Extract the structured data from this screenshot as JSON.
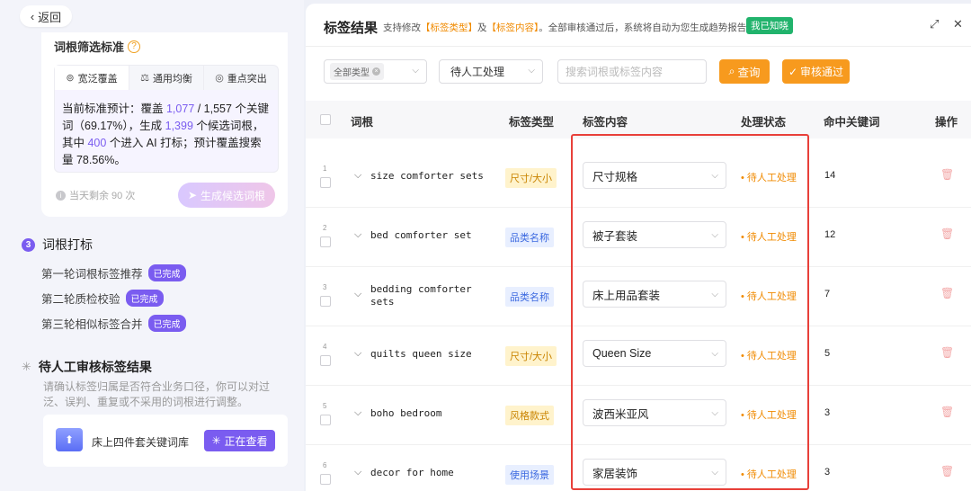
{
  "left": {
    "back_label": "返回",
    "card_title": "词根筛选标准",
    "help_symbol": "?",
    "tabs": [
      {
        "label": "宽泛覆盖",
        "icon": "broadcast-icon"
      },
      {
        "label": "通用均衡",
        "icon": "balance-icon"
      },
      {
        "label": "重点突出",
        "icon": "target-icon"
      }
    ],
    "estimate": {
      "t1": "当前标准预计：覆盖 ",
      "covered": "1,077",
      "t2": " / 1,557 个关键词（69.17%），生成 ",
      "generated": "1,399",
      "t3": " 个候选词根，其中 ",
      "ai_count": "400",
      "t4": " 个进入 AI 打标；预计覆盖搜索量 78.56%。"
    },
    "remain_text": "当天剩余 90 次",
    "generate_label": "生成候选词根",
    "step3": {
      "num": "3",
      "title": "词根打标"
    },
    "substeps": [
      {
        "label": "第一轮词根标签推荐",
        "badge": "已完成"
      },
      {
        "label": "第二轮质检校验",
        "badge": "已完成"
      },
      {
        "label": "第三轮相似标签合并",
        "badge": "已完成"
      }
    ],
    "step4": {
      "title": "待人工审核标签结果",
      "desc": "请确认标签归属是否符合业务口径，你可以对过泛、误判、重复或不采用的词根进行调整。"
    },
    "library": {
      "name": "床上四件套关键词库",
      "viewing_label": "正在查看"
    }
  },
  "right": {
    "title": "标签结果",
    "desc": {
      "a": "支持修改",
      "tag_type": "【标签类型】",
      "b": "及",
      "tag_content": "【标签内容】",
      "c": "。全部审核通过后，系统将自动为您生成趋势报告。"
    },
    "ack_label": "我已知晓",
    "filters": {
      "type_chip": "全部类型",
      "status_value": "待人工处理",
      "search_placeholder": "搜索词根或标签内容",
      "query_label": "查询",
      "approve_label": "审核通过"
    },
    "columns": {
      "root": "词根",
      "type": "标签类型",
      "content": "标签内容",
      "status": "处理状态",
      "hits": "命中关键词",
      "action": "操作"
    },
    "rows": [
      {
        "idx": "1",
        "root": "size comforter sets",
        "type": "尺寸/大小",
        "type_style": "y",
        "content": "尺寸规格",
        "status": "• 待人工处理",
        "hits": "14"
      },
      {
        "idx": "2",
        "root": "bed comforter set",
        "type": "品类名称",
        "type_style": "b",
        "content": "被子套装",
        "status": "• 待人工处理",
        "hits": "12"
      },
      {
        "idx": "3",
        "root": "bedding comforter sets",
        "type": "品类名称",
        "type_style": "b",
        "content": "床上用品套装",
        "status": "• 待人工处理",
        "hits": "7"
      },
      {
        "idx": "4",
        "root": "quilts queen size",
        "type": "尺寸/大小",
        "type_style": "y",
        "content": "Queen Size",
        "status": "• 待人工处理",
        "hits": "5"
      },
      {
        "idx": "5",
        "root": "boho bedroom",
        "type": "风格款式",
        "type_style": "y",
        "content": "波西米亚风",
        "status": "• 待人工处理",
        "hits": "3"
      },
      {
        "idx": "6",
        "root": "decor for home",
        "type": "使用场景",
        "type_style": "b",
        "content": "家居装饰",
        "status": "• 待人工处理",
        "hits": "3"
      }
    ]
  },
  "colors": {
    "accent_purple": "#7a5cf0",
    "accent_orange": "#f79a1e",
    "highlight_red": "#e8403a",
    "ack_green": "#21b36c"
  }
}
